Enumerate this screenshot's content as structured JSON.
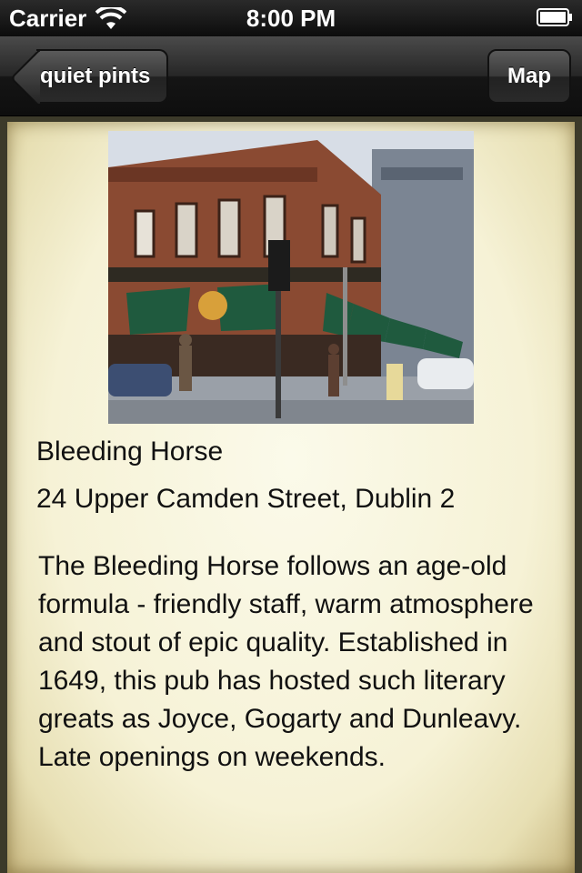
{
  "status_bar": {
    "carrier": "Carrier",
    "time": "8:00 PM"
  },
  "nav_bar": {
    "back_label": "quiet pints",
    "map_label": "Map"
  },
  "pub": {
    "name": "Bleeding Horse",
    "address": "24 Upper Camden Street, Dublin 2",
    "description": "The Bleeding Horse follows an age-old formula - friendly staff, warm atmosphere and stout of epic quality. Established in 1649, this pub has hosted such literary greats as Joyce, Gogarty and Dunleavy. Late openings on weekends."
  },
  "colors": {
    "nav_bar": "#1a1a1a",
    "paper": "#f6f2d6",
    "awning": "#1f5a3e",
    "brick": "#8a4a32"
  }
}
